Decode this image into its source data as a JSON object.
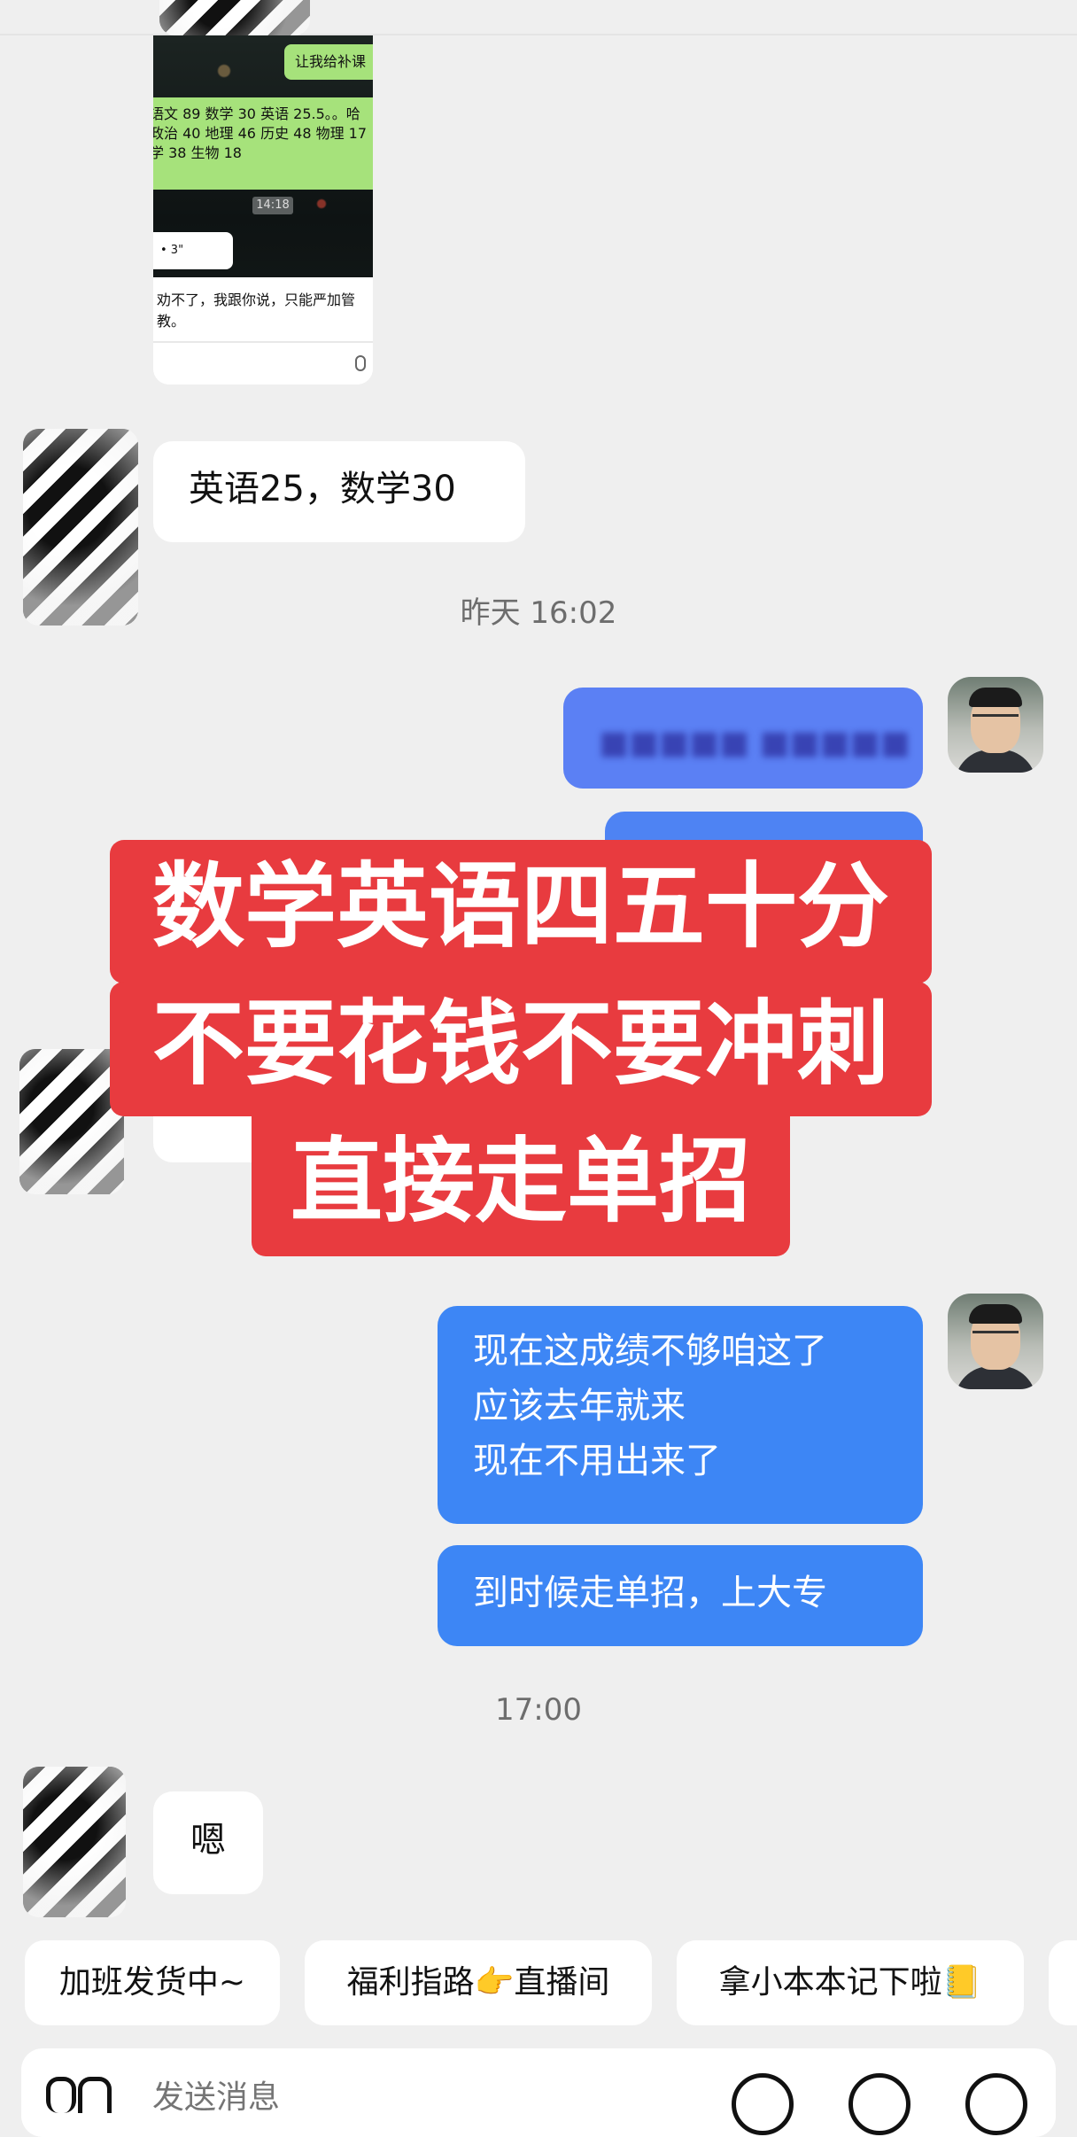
{
  "forwarded_screenshot": {
    "top_bubble_text": "让我给补课",
    "score_lines": [
      "语文 89 数学 30 英语 25.5。。哈",
      "政治 40 地理 46 历史 48 物理 17",
      "学 38 生物 18"
    ],
    "time": "14:18",
    "small_message": "• 3\"",
    "reply_lines": [
      "劝不了，我跟你说，只能严加管",
      "教。"
    ]
  },
  "messages": {
    "m1": "英语25，数学30",
    "ts1": "昨天 16:02",
    "m5_lines": [
      "现在这成绩不够咱这了",
      "应该去年就来",
      "现在不用出来了"
    ],
    "m6": "到时候走单招，上大专",
    "ts2": "17:00",
    "m7": "嗯"
  },
  "overlay": {
    "line1": "数学英语四五十分",
    "line2": "不要花钱不要冲刺",
    "line3": "直接走单招"
  },
  "quick_replies": [
    "加班发货中~",
    "福利指路👉直播间",
    "拿小本本记下啦📒"
  ],
  "composer": {
    "placeholder": "发送消息"
  },
  "colors": {
    "background": "#efefef",
    "bubble_sent": "#3d86f5",
    "bubble_received": "#ffffff",
    "overlay_red": "#e83b3f"
  },
  "icons": [
    "voice-icon",
    "emoji-icon",
    "more-icon",
    "add-icon",
    "mic-icon"
  ]
}
